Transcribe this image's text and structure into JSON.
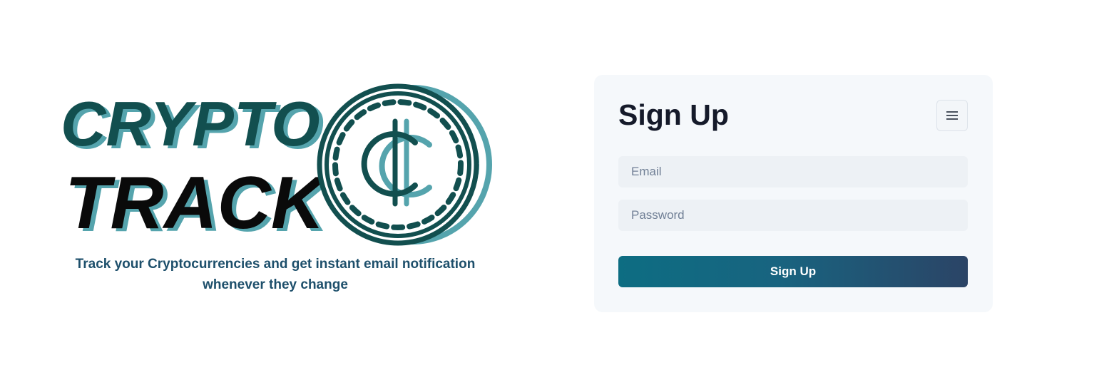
{
  "logo": {
    "line1": "CRYPTO",
    "line2": "TRACK",
    "coin_symbol": "₵",
    "colors": {
      "dark_teal": "#124f4f",
      "light_teal": "#55a4ad",
      "black": "#0a0a0a"
    }
  },
  "hero": {
    "tagline": "Track your Cryptocurrencies and get instant email notification whenever they change"
  },
  "signup": {
    "title": "Sign Up",
    "menu_icon": "hamburger-menu-icon",
    "email_placeholder": "Email",
    "password_placeholder": "Password",
    "submit_label": "Sign Up"
  },
  "colors": {
    "card_background": "#f5f8fb",
    "input_background": "#edf1f5",
    "button_gradient_start": "#0d6d82",
    "button_gradient_end": "#2b4466",
    "tagline": "#1d4f6b"
  }
}
